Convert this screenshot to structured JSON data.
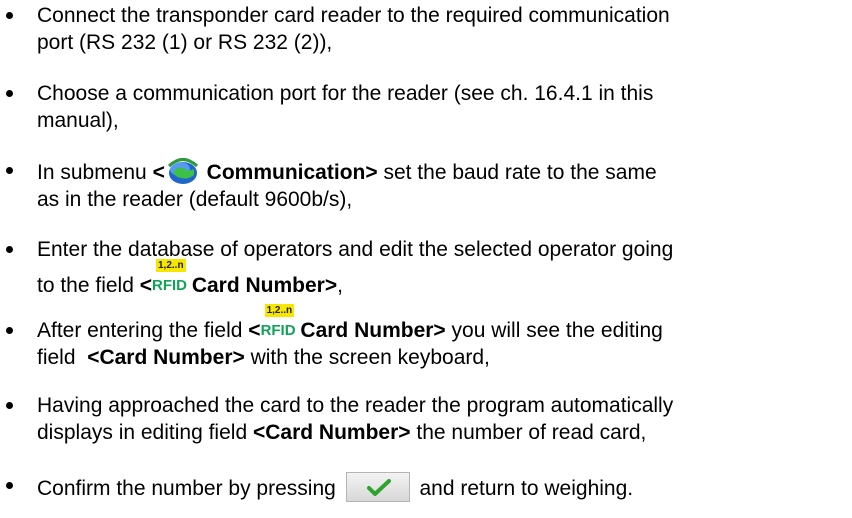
{
  "bullets": [
    {
      "line1": "Connect the transponder card reader to the required communication",
      "line2": "port (RS 232 (1) or RS 232 (2)),"
    },
    {
      "line1": "Choose a communication port for the reader (see ch. 16.4.1 in this",
      "line2": "manual),"
    },
    {
      "pre": "In submenu ",
      "open": "<",
      "bold": " Communication>",
      "post": " set the baud rate to the same",
      "line2": "as in the reader (default 9600b/s),"
    },
    {
      "line1": "Enter the database of operators and edit the selected operator going",
      "pre2": "to the field ",
      "open": "<",
      "bold": " Card Number>",
      "post": ","
    },
    {
      "pre": "After entering the field ",
      "open": "<",
      "bold": " Card Number>",
      "post": " you will see the editing",
      "line2_pre": "field  ",
      "line2_bold": "<Card Number>",
      "line2_post": " with the screen keyboard,"
    },
    {
      "line1": "Having approached the card to the reader the program automatically",
      "line2_pre": "displays in editing field ",
      "line2_bold": "<Card Number>",
      "line2_post": " the number of read card,"
    },
    {
      "pre": "Confirm the number by pressing ",
      "post": " and return to weighing."
    }
  ],
  "rfid_badge": "1,2..n",
  "rfid_word": "RFID",
  "icons": {
    "globe": "communication-globe-icon",
    "rfid": "rfid-card-number-icon",
    "confirm": "checkmark-icon"
  },
  "colors": {
    "rfid_green": "#12a35a",
    "badge_yellow": "#f7e700",
    "check_green": "#2fa32f"
  }
}
